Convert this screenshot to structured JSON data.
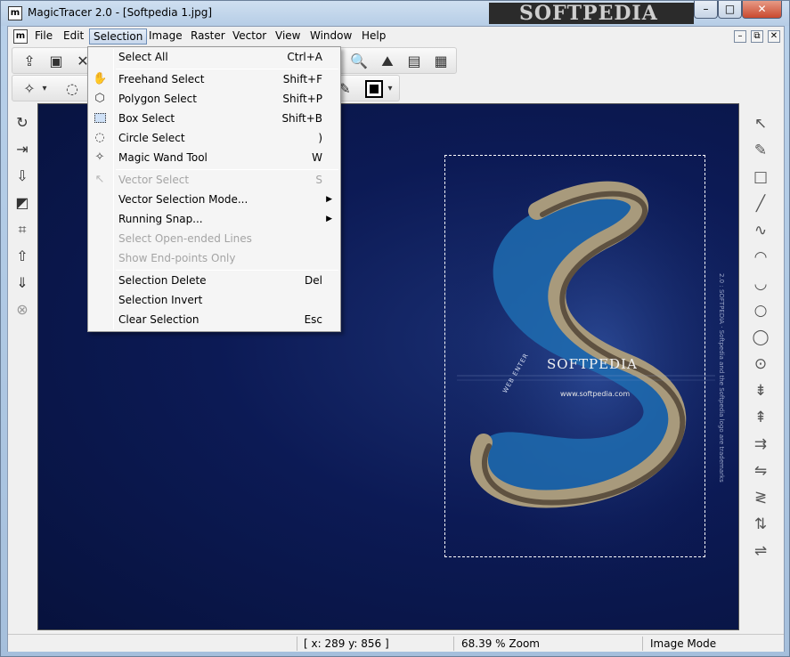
{
  "window": {
    "title": "MagicTracer 2.0 - [Softpedia 1.jpg]",
    "app_icon_glyph": "m",
    "watermark": "SOFTPEDIA",
    "min_glyph": "–",
    "max_glyph": "□",
    "close_glyph": "✕"
  },
  "menubar": {
    "doc_icon_glyph": "m",
    "items": [
      "File",
      "Edit",
      "Selection",
      "Image",
      "Raster",
      "Vector",
      "View",
      "Window",
      "Help"
    ],
    "mdi_min": "–",
    "mdi_restore": "⧉",
    "mdi_close": "✕"
  },
  "toolbar1": {
    "icons": [
      "import-icon",
      "save-icon",
      "close-icon",
      "zoom-icon",
      "raster-icon",
      "layers-icon",
      "grid-icon"
    ],
    "glyphs": [
      "⇪",
      "▣",
      "✕",
      "🔍",
      "⛰",
      "▤",
      "▦"
    ]
  },
  "toolbar2": {
    "icons": [
      "magic-wand-icon",
      "freehand-icon",
      "pen-icon"
    ],
    "glyphs": [
      "✧",
      "◌",
      "✎"
    ],
    "dropdown_glyph": "▾"
  },
  "left_tools": {
    "icons": [
      "rotate-icon",
      "export-icon",
      "flip-down-icon",
      "fill-icon",
      "crop-icon",
      "move-up-icon",
      "move-down-icon",
      "cancel-icon"
    ],
    "glyphs": [
      "↻",
      "⇥",
      "⇩",
      "◩",
      "⌗",
      "⇧",
      "⇓",
      "⊗"
    ]
  },
  "right_tools": {
    "icons": [
      "pointer-icon",
      "pencil-icon",
      "rectangle-icon",
      "line-icon",
      "curve-icon",
      "arc-icon",
      "arc2-icon",
      "circle-icon",
      "circle2-icon",
      "circle-point-icon",
      "align-top-icon",
      "align-bottom-icon",
      "merge-icon",
      "join-icon",
      "collapse-icon",
      "swap-icon",
      "distribute-icon"
    ],
    "glyphs": [
      "↖",
      "✎",
      "□",
      "╱",
      "∿",
      "◠",
      "◡",
      "○",
      "◯",
      "⊙",
      "⇟",
      "⇞",
      "⇉",
      "⇋",
      "≷",
      "⇅",
      "⇌"
    ]
  },
  "canvas": {
    "brand": "SOFTPEDIA",
    "brand_url": "www.softpedia.com",
    "web_enter": "WEB ENTER",
    "side_credit": "2.0 : SOFTPEDIA · Softpedia and the Softpedia logo are trademarks"
  },
  "statusbar": {
    "coords": "[ x: 289 y: 856 ]",
    "zoom": "68.39 % Zoom",
    "mode": "Image Mode"
  },
  "selection_menu": {
    "items": [
      {
        "label": "Select All",
        "shortcut": "Ctrl+A",
        "icon": "",
        "disabled": false
      },
      {
        "label": "Freehand Select",
        "shortcut": "Shift+F",
        "icon": "✋",
        "disabled": false
      },
      {
        "label": "Polygon Select",
        "shortcut": "Shift+P",
        "icon": "⬡",
        "disabled": false
      },
      {
        "label": "Box Select",
        "shortcut": "Shift+B",
        "icon": "",
        "disabled": false
      },
      {
        "label": "Circle Select",
        "shortcut": ")",
        "icon": "◌",
        "disabled": false
      },
      {
        "label": "Magic Wand Tool",
        "shortcut": "W",
        "icon": "✧",
        "disabled": false
      },
      {
        "label": "Vector Select",
        "shortcut": "S",
        "icon": "↖",
        "disabled": true
      },
      {
        "label": "Vector Selection Mode...",
        "shortcut": "",
        "icon": "",
        "disabled": false,
        "submenu": true
      },
      {
        "label": "Running Snap...",
        "shortcut": "",
        "icon": "",
        "disabled": false,
        "submenu": true
      },
      {
        "label": "Select Open-ended Lines",
        "shortcut": "",
        "icon": "",
        "disabled": true
      },
      {
        "label": "Show End-points Only",
        "shortcut": "",
        "icon": "",
        "disabled": true
      },
      {
        "label": "Selection Delete",
        "shortcut": "Del",
        "icon": "",
        "disabled": false
      },
      {
        "label": "Selection Invert",
        "shortcut": "",
        "icon": "",
        "disabled": false
      },
      {
        "label": "Clear Selection",
        "shortcut": "Esc",
        "icon": "",
        "disabled": false
      }
    ],
    "submenu_arrow": "▶"
  }
}
